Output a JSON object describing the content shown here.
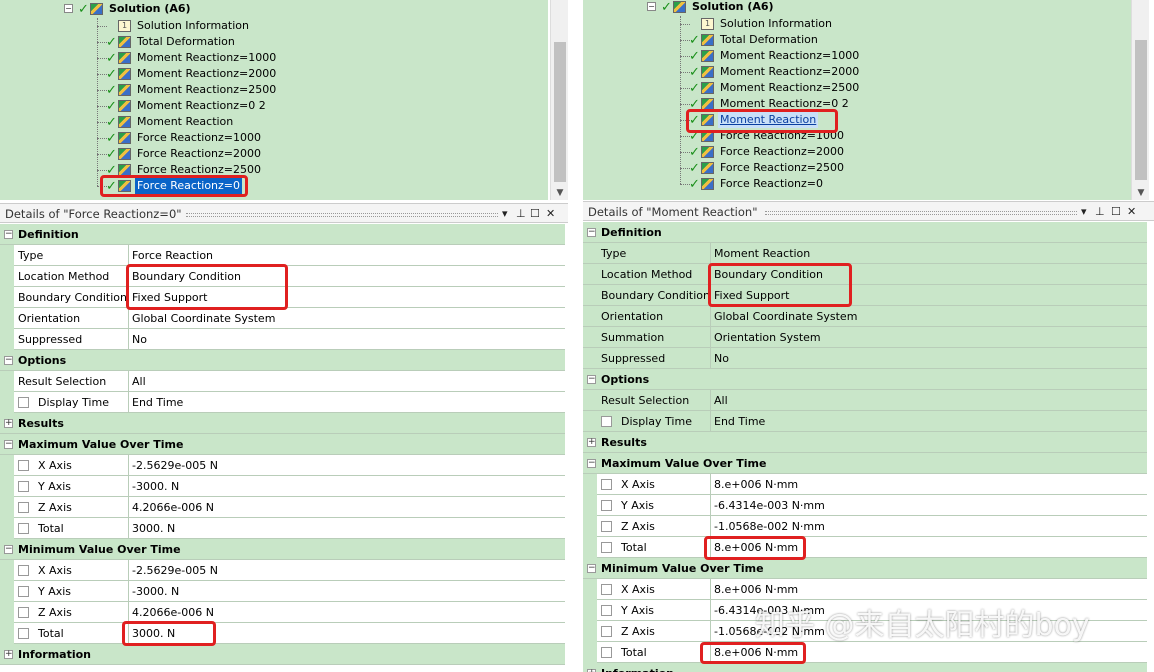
{
  "left": {
    "tree": {
      "root": "Solution (A6)",
      "items": [
        {
          "label": "Solution Information",
          "icon": "solution-info-icon"
        },
        {
          "label": "Total Deformation",
          "icon": "result-icon"
        },
        {
          "label": "Moment Reactionz=1000",
          "icon": "result-icon"
        },
        {
          "label": "Moment Reactionz=2000",
          "icon": "result-icon"
        },
        {
          "label": "Moment Reactionz=2500",
          "icon": "result-icon"
        },
        {
          "label": "Moment Reactionz=0 2",
          "icon": "result-icon"
        },
        {
          "label": "Moment Reaction",
          "icon": "result-icon"
        },
        {
          "label": "Force Reactionz=1000",
          "icon": "result-icon"
        },
        {
          "label": "Force Reactionz=2000",
          "icon": "result-icon"
        },
        {
          "label": "Force Reactionz=2500",
          "icon": "result-icon"
        },
        {
          "label": "Force Reactionz=0",
          "icon": "result-icon",
          "selected": true
        }
      ]
    },
    "details": {
      "title": "Details of \"Force Reactionz=0\"",
      "controls": [
        "▾",
        "⊥",
        "☐",
        "✕"
      ],
      "definition": {
        "header": "Definition",
        "type_label": "Type",
        "type_value": "Force Reaction",
        "location_label": "Location Method",
        "location_value": "Boundary Condition",
        "bc_label": "Boundary Condition",
        "bc_value": "Fixed Support",
        "orient_label": "Orientation",
        "orient_value": "Global Coordinate System",
        "supp_label": "Suppressed",
        "supp_value": "No"
      },
      "options": {
        "header": "Options",
        "rs_label": "Result Selection",
        "rs_value": "All",
        "dt_label": "Display Time",
        "dt_value": "End Time"
      },
      "results": {
        "header": "Results"
      },
      "max": {
        "header": "Maximum Value Over Time",
        "x_label": "X Axis",
        "x_value": "-2.5629e-005 N",
        "y_label": "Y Axis",
        "y_value": "-3000. N",
        "z_label": "Z Axis",
        "z_value": "4.2066e-006 N",
        "t_label": "Total",
        "t_value": "3000. N"
      },
      "min": {
        "header": "Minimum Value Over Time",
        "x_label": "X Axis",
        "x_value": "-2.5629e-005 N",
        "y_label": "Y Axis",
        "y_value": "-3000. N",
        "z_label": "Z Axis",
        "z_value": "4.2066e-006 N",
        "t_label": "Total",
        "t_value": "3000. N"
      },
      "information": {
        "header": "Information"
      }
    }
  },
  "right": {
    "tree": {
      "root": "Solution (A6)",
      "items": [
        {
          "label": "Solution Information",
          "icon": "solution-info-icon"
        },
        {
          "label": "Total Deformation",
          "icon": "result-icon"
        },
        {
          "label": "Moment Reactionz=1000",
          "icon": "result-icon"
        },
        {
          "label": "Moment Reactionz=2000",
          "icon": "result-icon"
        },
        {
          "label": "Moment Reactionz=2500",
          "icon": "result-icon"
        },
        {
          "label": "Moment Reactionz=0 2",
          "icon": "result-icon"
        },
        {
          "label": "Moment Reaction",
          "icon": "result-icon",
          "selected": true
        },
        {
          "label": "Force Reactionz=1000",
          "icon": "result-icon"
        },
        {
          "label": "Force Reactionz=2000",
          "icon": "result-icon"
        },
        {
          "label": "Force Reactionz=2500",
          "icon": "result-icon"
        },
        {
          "label": "Force Reactionz=0",
          "icon": "result-icon"
        }
      ]
    },
    "details": {
      "title": "Details of \"Moment Reaction\"",
      "controls": [
        "▾",
        "⊥",
        "☐",
        "✕"
      ],
      "definition": {
        "header": "Definition",
        "type_label": "Type",
        "type_value": "Moment Reaction",
        "location_label": "Location Method",
        "location_value": "Boundary Condition",
        "bc_label": "Boundary Condition",
        "bc_value": "Fixed Support",
        "orient_label": "Orientation",
        "orient_value": "Global Coordinate System",
        "sum_label": "Summation",
        "sum_value": "Orientation System",
        "supp_label": "Suppressed",
        "supp_value": "No"
      },
      "options": {
        "header": "Options",
        "rs_label": "Result Selection",
        "rs_value": "All",
        "dt_label": "Display Time",
        "dt_value": "End Time"
      },
      "results": {
        "header": "Results"
      },
      "max": {
        "header": "Maximum Value Over Time",
        "x_label": "X Axis",
        "x_value": "8.e+006 N·mm",
        "y_label": "Y Axis",
        "y_value": "-6.4314e-003 N·mm",
        "z_label": "Z Axis",
        "z_value": "-1.0568e-002 N·mm",
        "t_label": "Total",
        "t_value": "8.e+006 N·mm"
      },
      "min": {
        "header": "Minimum Value Over Time",
        "x_label": "X Axis",
        "x_value": "8.e+006 N·mm",
        "y_label": "Y Axis",
        "y_value": "-6.4314e-003 N·mm",
        "z_label": "Z Axis",
        "z_value": "-1.0568e-002 N·mm",
        "t_label": "Total",
        "t_value": "8.e+006 N·mm"
      },
      "information": {
        "header": "Information"
      }
    }
  },
  "watermark": "知乎 @来自太阳村的boy",
  "colors": {
    "highlight": "#e02020",
    "tree_bg": "#c9e6c9",
    "selection": "#0a64c8"
  }
}
